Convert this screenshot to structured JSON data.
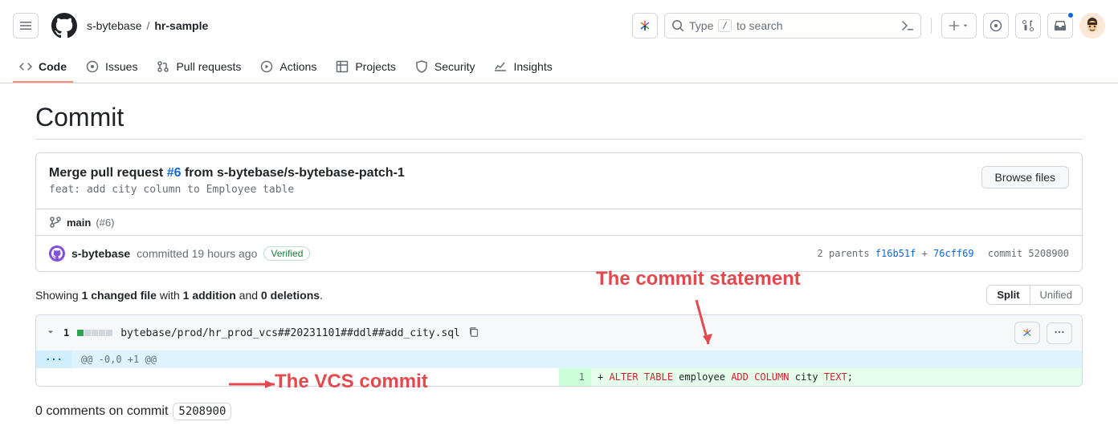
{
  "header": {
    "owner": "s-bytebase",
    "repo": "hr-sample",
    "search_prefix": "Type",
    "search_key": "/",
    "search_suffix": "to search"
  },
  "tabs": {
    "code": "Code",
    "issues": "Issues",
    "pulls": "Pull requests",
    "actions": "Actions",
    "projects": "Projects",
    "security": "Security",
    "insights": "Insights"
  },
  "page_title": "Commit",
  "commit": {
    "title_prefix": "Merge pull request ",
    "pr_link": "#6",
    "title_suffix": " from s-bytebase/s-bytebase-patch-1",
    "description": "feat: add city column to Employee table",
    "browse_label": "Browse files",
    "branch": "main",
    "pr_ref": "(#6)",
    "author": "s-bytebase",
    "committed_text": "committed 19 hours ago",
    "verified": "Verified",
    "parents_label": "2 parents ",
    "parent1": "f16b51f",
    "plus": " + ",
    "parent2": "76cff69",
    "commit_label": "commit ",
    "sha": "5208900"
  },
  "summary": {
    "showing": "Showing ",
    "files": "1 changed file",
    "with": " with ",
    "adds": "1 addition",
    "and": " and ",
    "dels": "0 deletions",
    "period": ".",
    "split": "Split",
    "unified": "Unified"
  },
  "file": {
    "count": "1",
    "path": "bytebase/prod/hr_prod_vcs##20231101##ddl##add_city.sql",
    "hunk": "@@ -0,0 +1 @@",
    "line_no": "1",
    "code_plus": "+ ",
    "kw1": "ALTER",
    "kw2": "TABLE",
    "tbl": "employee",
    "kw3": "ADD",
    "kw4": "COLUMN",
    "col": "city",
    "type": "TEXT",
    "semi": ";"
  },
  "comments": {
    "prefix": "0 comments on commit",
    "sha": "5208900"
  },
  "annotations": {
    "stmt": "The commit statement",
    "vcs": "The VCS commit"
  }
}
